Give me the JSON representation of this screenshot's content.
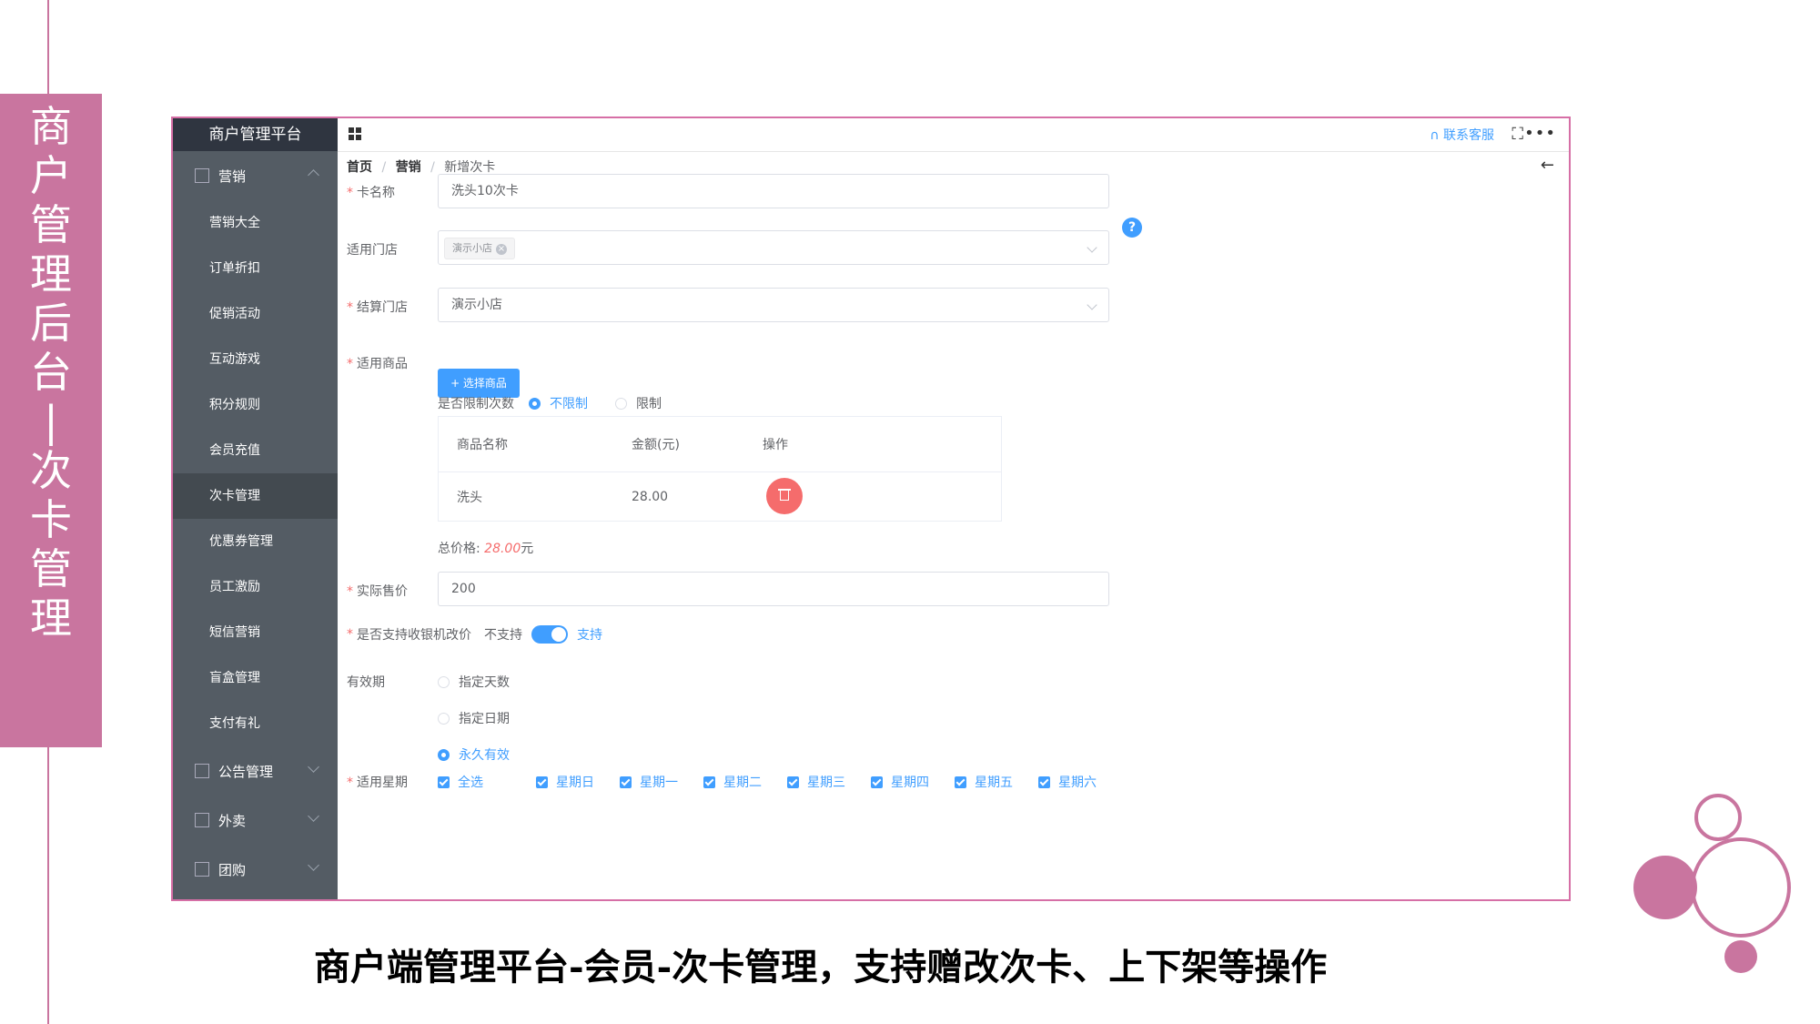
{
  "side_title_chars": [
    "商",
    "户",
    "管",
    "理",
    "后",
    "台",
    "|",
    "次",
    "卡",
    "管",
    "理"
  ],
  "caption": "商户端管理平台-会员-次卡管理，支持赠改次卡、上下架等操作",
  "colors": {
    "accent_pink": "#c9759f",
    "frame_pink": "#d66fa6",
    "primary": "#409eff",
    "danger": "#f56c6c",
    "sidebar_bg": "#545c64"
  },
  "app": {
    "brand": "商户管理平台",
    "header": {
      "contact_label": "联系客服",
      "contact_icon": "headset-icon",
      "fullscreen_icon": "fullscreen-icon",
      "more_icon": "more-icon"
    },
    "sidebar": {
      "group_marketing": "营销",
      "items": [
        "营销大全",
        "订单折扣",
        "促销活动",
        "互动游戏",
        "积分规则",
        "会员充值",
        "次卡管理",
        "优惠券管理",
        "员工激励",
        "短信营销",
        "盲盒管理",
        "支付有礼"
      ],
      "active_item": "次卡管理",
      "group_notice": "公告管理",
      "group_takeout": "外卖",
      "group_groupbuy": "团购"
    },
    "breadcrumb": {
      "home": "首页",
      "sep1": "/",
      "section": "营销",
      "sep2": "/",
      "current": "新增次卡"
    },
    "form": {
      "card_name": {
        "label": "卡名称",
        "value": "洗头10次卡"
      },
      "stores": {
        "label": "适用门店",
        "tag": "演示小店",
        "help": "?"
      },
      "settle_store": {
        "label": "结算门店",
        "value": "演示小店"
      },
      "goods": {
        "label": "适用商品",
        "button": "+ 选择商品",
        "limit_label": "是否限制次数",
        "limit_options": [
          "不限制",
          "限制"
        ],
        "limit_selected": "不限制",
        "table": {
          "headers": [
            "商品名称",
            "金额(元)",
            "操作"
          ],
          "rows": [
            {
              "name": "洗头",
              "amount": "28.00"
            }
          ]
        },
        "total_label": "总价格:",
        "total_value": "28.00",
        "total_unit": "元"
      },
      "actual_price": {
        "label": "实际售价",
        "value": "200"
      },
      "cashier_change": {
        "label": "是否支持收银机改价",
        "off_text": "不支持",
        "on_text": "支持",
        "enabled": true
      },
      "validity": {
        "label": "有效期",
        "options": [
          "指定天数",
          "指定日期",
          "永久有效"
        ],
        "selected": "永久有效"
      },
      "weekdays": {
        "label": "适用星期",
        "options": [
          "全选",
          "星期日",
          "星期一",
          "星期二",
          "星期三",
          "星期四",
          "星期五",
          "星期六"
        ],
        "all_checked": true
      }
    }
  }
}
